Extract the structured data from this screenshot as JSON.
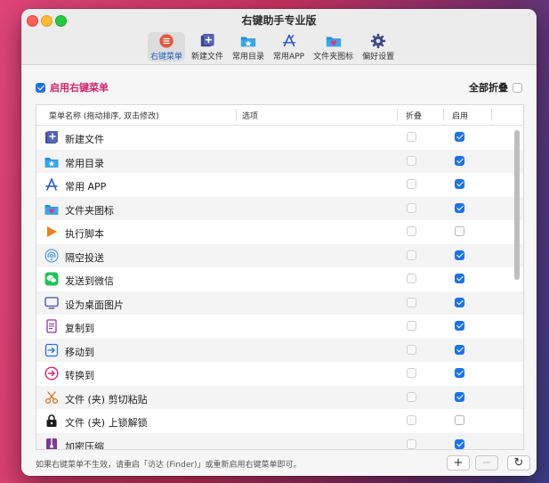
{
  "window": {
    "title": "右键助手专业版"
  },
  "toolbar": {
    "items": [
      {
        "label": "右键菜单",
        "icon": "menu-circle-icon",
        "active": true
      },
      {
        "label": "新建文件",
        "icon": "new-file-icon",
        "active": false
      },
      {
        "label": "常用目录",
        "icon": "folder-star-icon",
        "active": false
      },
      {
        "label": "常用APP",
        "icon": "app-store-icon",
        "active": false
      },
      {
        "label": "文件夹图标",
        "icon": "folder-heart-icon",
        "active": false
      },
      {
        "label": "偏好设置",
        "icon": "gear-icon",
        "active": false
      }
    ]
  },
  "top": {
    "enable_label": "启用右键菜单",
    "enable_checked": true,
    "collapse_all_label": "全部折叠",
    "collapse_all_checked": false
  },
  "table": {
    "headers": {
      "name": "菜单名称 (拖动排序, 双击修改)",
      "options": "选项",
      "fold": "折叠",
      "enable": "启用"
    },
    "rows": [
      {
        "name": "新建文件",
        "icon": "new-file-icon",
        "fold": false,
        "enabled": true
      },
      {
        "name": "常用目录",
        "icon": "folder-star-icon",
        "fold": false,
        "enabled": true
      },
      {
        "name": "常用 APP",
        "icon": "app-store-icon",
        "fold": false,
        "enabled": true
      },
      {
        "name": "文件夹图标",
        "icon": "folder-heart-icon",
        "fold": false,
        "enabled": true
      },
      {
        "name": "执行脚本",
        "icon": "play-icon",
        "fold": false,
        "enabled": false
      },
      {
        "name": "隔空投送",
        "icon": "airdrop-icon",
        "fold": false,
        "enabled": true
      },
      {
        "name": "发送到微信",
        "icon": "wechat-icon",
        "fold": false,
        "enabled": true
      },
      {
        "name": "设为桌面图片",
        "icon": "monitor-icon",
        "fold": false,
        "enabled": true
      },
      {
        "name": "复制到",
        "icon": "copy-doc-icon",
        "fold": false,
        "enabled": true
      },
      {
        "name": "移动到",
        "icon": "move-to-icon",
        "fold": false,
        "enabled": true
      },
      {
        "name": "转换到",
        "icon": "convert-arrow-icon",
        "fold": false,
        "enabled": true
      },
      {
        "name": "文件 (夹) 剪切粘贴",
        "icon": "scissors-icon",
        "fold": false,
        "enabled": true
      },
      {
        "name": "文件 (夹) 上锁解锁",
        "icon": "lock-icon",
        "fold": false,
        "enabled": false
      },
      {
        "name": "加密压缩",
        "icon": "archive-icon",
        "fold": false,
        "enabled": true
      }
    ]
  },
  "footer": {
    "hint": "如果右键菜单不生效，请重启「访达 (Finder)」或重新启用右键菜单即可。",
    "add_label": "+",
    "remove_label": "−",
    "refresh_label": "↻"
  }
}
